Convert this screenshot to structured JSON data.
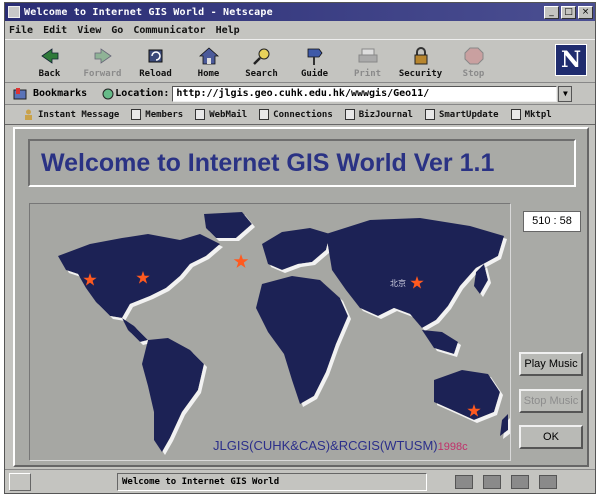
{
  "window": {
    "title": "Welcome to Internet GIS World - Netscape"
  },
  "menu": [
    "File",
    "Edit",
    "View",
    "Go",
    "Communicator",
    "Help"
  ],
  "toolbar": {
    "back": "Back",
    "forward": "Forward",
    "reload": "Reload",
    "home": "Home",
    "search": "Search",
    "guide": "Guide",
    "print": "Print",
    "security": "Security",
    "stop": "Stop"
  },
  "location": {
    "bookmarks_label": "Bookmarks",
    "location_label": "Location:",
    "url": "http://jlgis.geo.cuhk.edu.hk/wwwgis/Geo11/"
  },
  "personal_toolbar": [
    "Instant Message",
    "Members",
    "WebMail",
    "Connections",
    "BizJournal",
    "SmartUpdate",
    "Mktpl"
  ],
  "page": {
    "heading": "Welcome to Internet GIS World Ver 1.1",
    "coordinates": "510 : 58",
    "play_music": "Play Music",
    "stop_music": "Stop Music",
    "ok": "OK",
    "credit": "JLGIS(CUHK&CAS)&RCGIS(WTUSM)",
    "credit_year": "1998c",
    "map_city_label": "北京"
  },
  "status": {
    "text": "Welcome to Internet GIS World"
  },
  "colors": {
    "title_bar": "#2a2d74",
    "heading": "#2a3284",
    "map_land": "#1f2354",
    "marker": "#ff5a1f"
  }
}
